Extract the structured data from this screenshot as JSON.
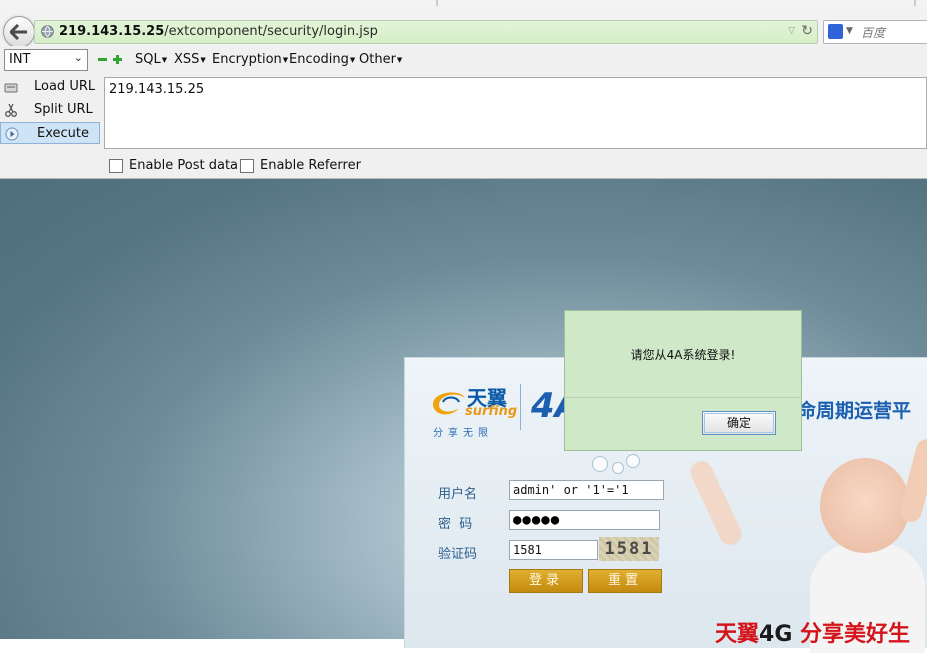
{
  "browser": {
    "url_host": "219.143.15.25",
    "url_path": "/extcomponent/security/login.jsp",
    "search_placeholder": "百度"
  },
  "hackbar": {
    "select_value": "INT",
    "menus": [
      "SQL",
      "XSS",
      "Encryption",
      "Encoding",
      "Other"
    ],
    "load_url": "Load URL",
    "split_url": "Split URL",
    "execute": "Execute",
    "payload": "219.143.15.25",
    "enable_post": "Enable Post data",
    "enable_referrer": "Enable Referrer"
  },
  "login": {
    "logo_cn": "天翼",
    "logo_en": "surfing",
    "logo_slogan": "分享无限",
    "logo_4a": "4A",
    "platform_title": "命周期运营平",
    "username_label": "用户名",
    "username_value": "admin' or '1'='1",
    "password_label": "密  码",
    "password_value": "●●●●●",
    "captcha_label": "验证码",
    "captcha_value": "1581",
    "captcha_image_text": "1581",
    "login_button": "登录",
    "reset_button": "重置",
    "slogan_prefix": "天翼",
    "slogan_4g": "4G",
    "slogan_suffix": " 分享美好生"
  },
  "dialog": {
    "message": "请您从4A系统登录!",
    "ok_button": "确定"
  }
}
